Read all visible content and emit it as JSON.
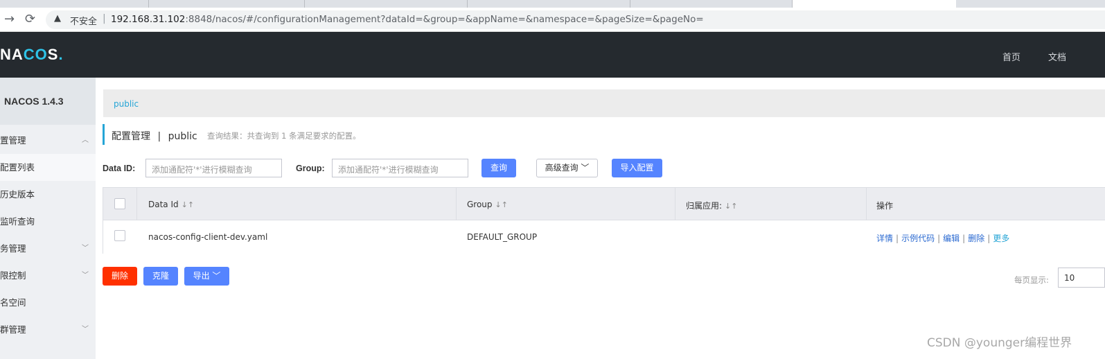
{
  "browser": {
    "insecure_label": "不安全",
    "url_host": "192.168.31.102",
    "url_rest": ":8848/nacos/#/configurationManagement?dataId=&group=&appName=&namespace=&pageSize=&pageNo="
  },
  "header": {
    "logo_part1": "N",
    "logo_part2": "A",
    "logo_part3": "C",
    "logo_part4": "O",
    "logo_part5": "S",
    "logo_dot": ".",
    "nav": [
      "首页",
      "文档"
    ]
  },
  "sidebar": {
    "version": "NACOS 1.4.3",
    "items": [
      {
        "label": "置管理",
        "chevron": "^"
      },
      {
        "label": "配置列表",
        "chevron": ""
      },
      {
        "label": "历史版本",
        "chevron": ""
      },
      {
        "label": "监听查询",
        "chevron": ""
      },
      {
        "label": "务管理",
        "chevron": "v"
      },
      {
        "label": "限控制",
        "chevron": "v"
      },
      {
        "label": "名空间",
        "chevron": ""
      },
      {
        "label": "群管理",
        "chevron": "v"
      }
    ]
  },
  "main": {
    "namespace_tab": "public",
    "title": "配置管理",
    "title_sep": "|",
    "title_ns": "public",
    "query_result": "查询结果：共查询到 1 条满足要求的配置。",
    "filters": {
      "dataid_label": "Data ID:",
      "dataid_placeholder": "添加通配符'*'进行模糊查询",
      "group_label": "Group:",
      "group_placeholder": "添加通配符'*'进行模糊查询",
      "query_button": "查询",
      "advanced_button": "高级查询",
      "import_button": "导入配置"
    },
    "table": {
      "headers": [
        "Data Id",
        "Group",
        "归属应用:",
        "操作"
      ],
      "sort_icon": "↓↑",
      "rows": [
        {
          "data_id": "nacos-config-client-dev.yaml",
          "group": "DEFAULT_GROUP",
          "app": "",
          "ops": [
            "详情",
            "示例代码",
            "编辑",
            "删除",
            "更多"
          ]
        }
      ]
    },
    "bulk": {
      "delete_button": "删除",
      "clone_button": "克隆",
      "export_button": "导出"
    },
    "pager": {
      "per_page_label": "每页显示:",
      "per_page_value": "10"
    }
  },
  "watermark": "CSDN @younger编程世界",
  "colors": {
    "header_bg": "#252a2f",
    "accent": "#25a5d6",
    "primary_button": "#5584ff",
    "danger_button": "#ff3000"
  }
}
